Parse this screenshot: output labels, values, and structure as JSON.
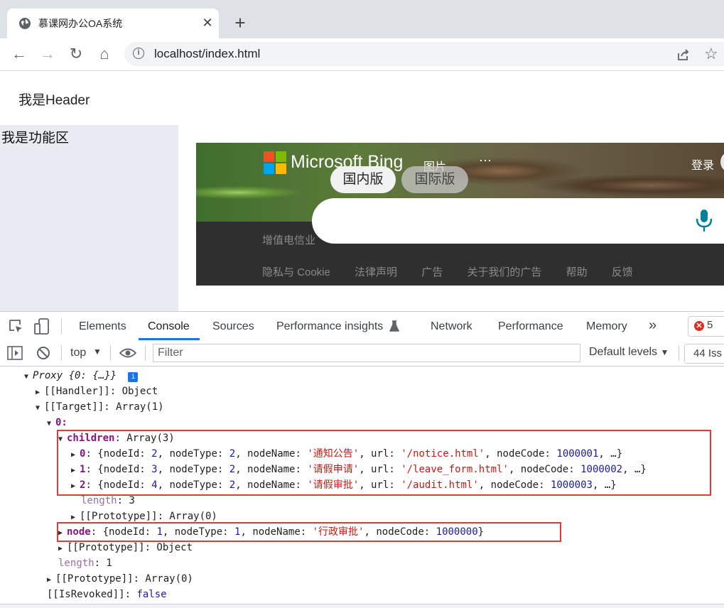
{
  "browser": {
    "tab_title": "慕课网办公OA系统",
    "tab_close": "✕",
    "new_tab": "+",
    "url": "localhost/index.html",
    "nav": {
      "back": "←",
      "forward": "→",
      "reload": "↻",
      "home": "⌂"
    },
    "toolbar_icons": {
      "share": "share-icon",
      "bookmark": "☆"
    }
  },
  "page": {
    "header_text": "我是Header",
    "sidebar_text": "我是功能区"
  },
  "bing": {
    "brand": "Microsoft Bing",
    "images_link": "图片",
    "more": "···",
    "login": "登录",
    "pills": [
      "国内版",
      "国际版"
    ],
    "icp_text": "增值电信业",
    "footer_links": [
      "隐私与 Cookie",
      "法律声明",
      "广告",
      "关于我们的广告",
      "帮助",
      "反馈"
    ]
  },
  "devtools": {
    "tabs": [
      "Elements",
      "Console",
      "Sources",
      "Performance insights",
      "Network",
      "Performance",
      "Memory"
    ],
    "more": "»",
    "error_count": "5",
    "context": "top",
    "filter_placeholder": "Filter",
    "levels": "Default levels",
    "issues": "44 Iss",
    "console_lines": {
      "proxy": "Proxy {0: {…}}",
      "handler": "[[Handler]]: Object",
      "target": "[[Target]]: Array(1)",
      "idx0": "0:",
      "children_key": "children",
      "children_val": ": Array(3)",
      "child0": {
        "idx": "0",
        "pre": ": {nodeId: ",
        "id": "2",
        "mid1": ", nodeType: ",
        "type": "2",
        "mid2": ", nodeName: ",
        "name": "'通知公告'",
        "mid3": ", url: ",
        "url": "'/notice.html'",
        "mid4": ", nodeCode: ",
        "code": "1000001",
        "post": ", …}"
      },
      "child1": {
        "idx": "1",
        "pre": ": {nodeId: ",
        "id": "3",
        "mid1": ", nodeType: ",
        "type": "2",
        "mid2": ", nodeName: ",
        "name": "'请假申请'",
        "mid3": ", url: ",
        "url": "'/leave_form.html'",
        "mid4": ", nodeCode: ",
        "code": "1000002",
        "post": ", …}"
      },
      "child2": {
        "idx": "2",
        "pre": ": {nodeId: ",
        "id": "4",
        "mid1": ", nodeType: ",
        "type": "2",
        "mid2": ", nodeName: ",
        "name": "'请假审批'",
        "mid3": ", url: ",
        "url": "'/audit.html'",
        "mid4": ", nodeCode: ",
        "code": "1000003",
        "post": ", …}"
      },
      "length_key": "length",
      "length_val": ": 3",
      "proto_arr0": "[[Prototype]]: Array(0)",
      "node": {
        "key": "node",
        "pre": ": {nodeId: ",
        "id": "1",
        "mid1": ", nodeType: ",
        "type": "1",
        "mid2": ", nodeName: ",
        "name": "'行政审批'",
        "mid3": ", nodeCode: ",
        "code": "1000000",
        "post": "}"
      },
      "proto_obj": "[[Prototype]]: Object",
      "length2_key": "length",
      "length2_val": ": 1",
      "proto_arr1": "[[Prototype]]: Array(0)",
      "revoked_key": "[[IsRevoked]]",
      "revoked_val": "false"
    }
  }
}
